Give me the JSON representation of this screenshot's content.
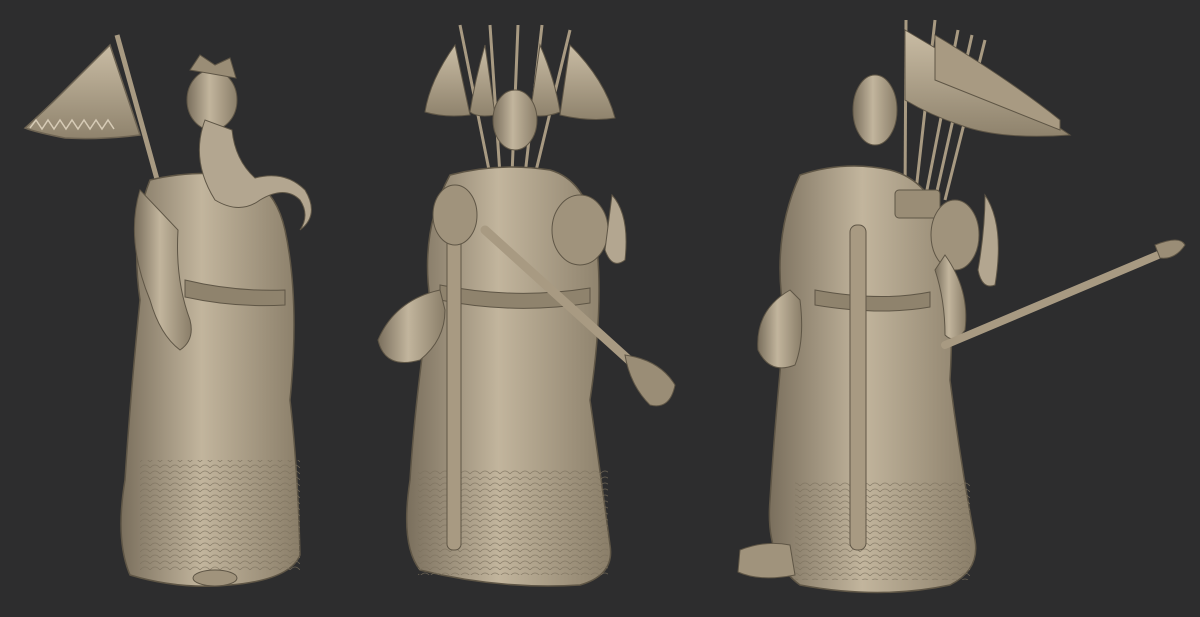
{
  "scene": {
    "background_color": "#2d2d2e",
    "material_color": "#b3a690",
    "material_dark": "#6e6453",
    "material_light": "#d6cbb6",
    "views": [
      {
        "name": "left-three-quarter-view"
      },
      {
        "name": "back-view"
      },
      {
        "name": "right-three-quarter-back-view"
      }
    ]
  }
}
